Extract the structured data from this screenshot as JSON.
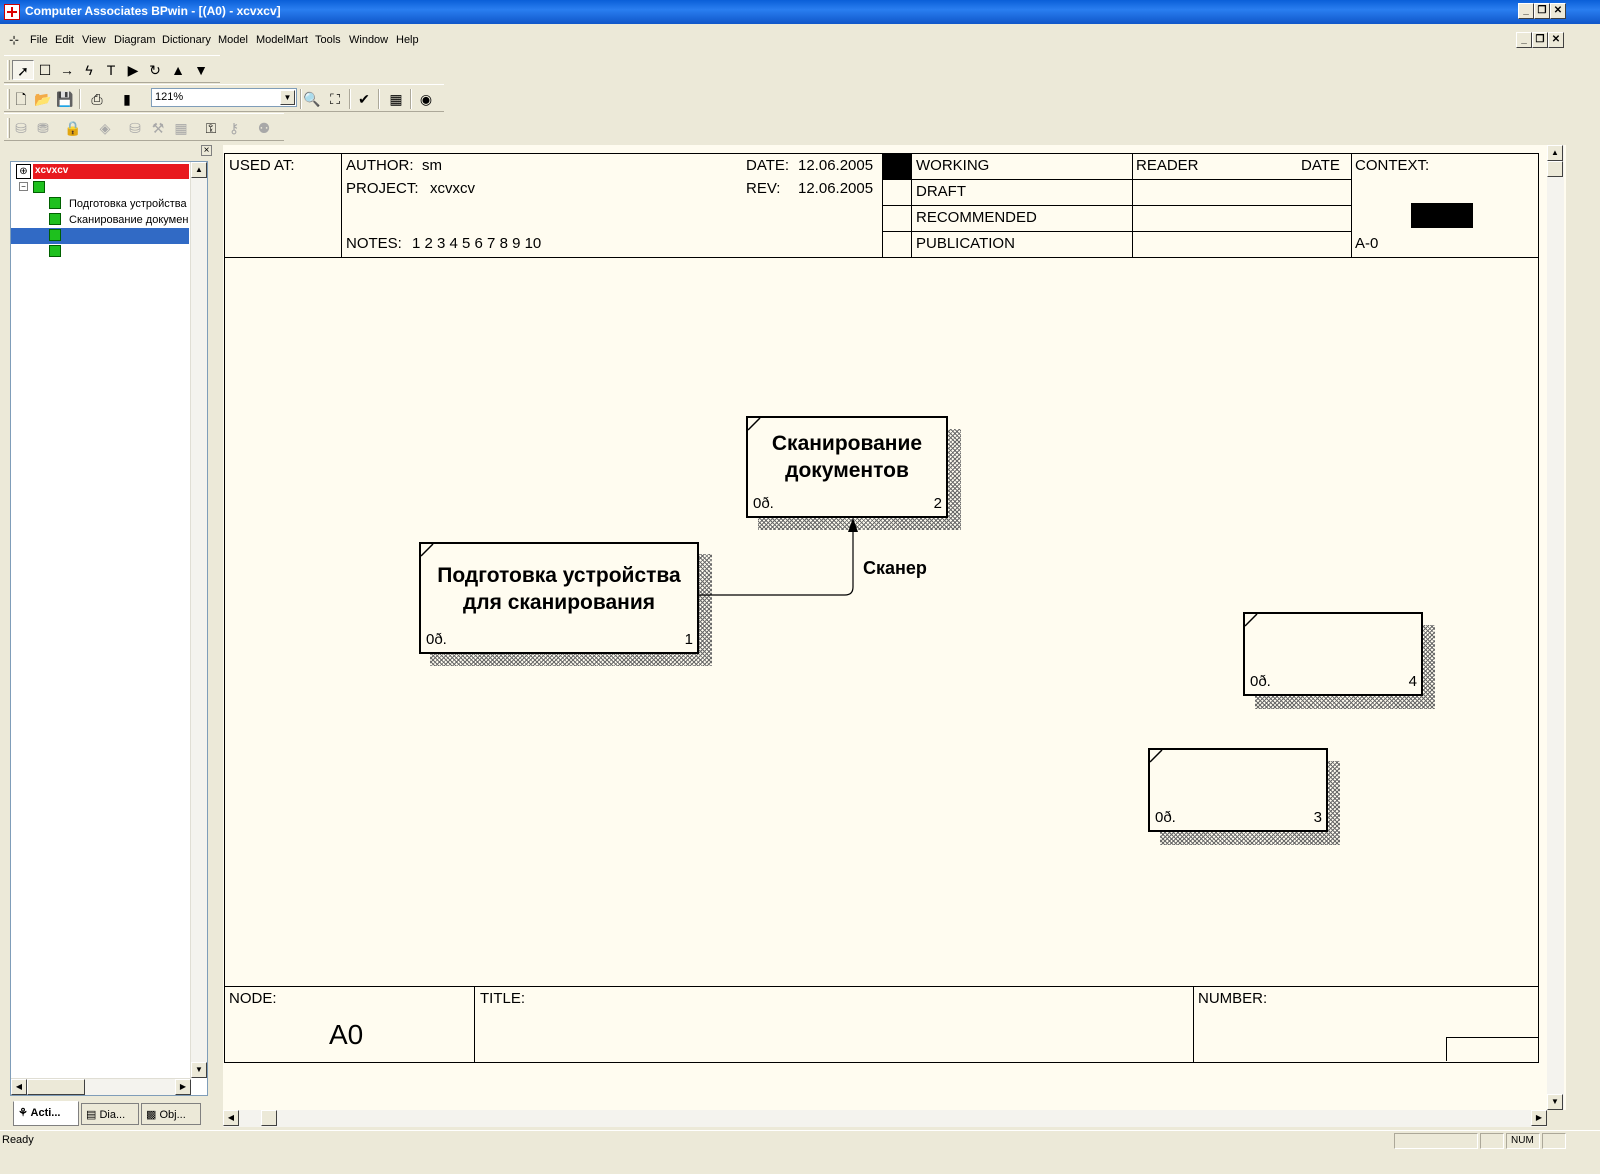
{
  "window": {
    "title": "Computer Associates BPwin - [(A0)  - xcvxcv]",
    "min_glyph": "_",
    "restore_glyph": "❐",
    "close_glyph": "✕"
  },
  "menu": [
    "File",
    "Edit",
    "View",
    "Diagram",
    "Dictionary",
    "Model",
    "ModelMart",
    "Tools",
    "Window",
    "Help"
  ],
  "toolbar": {
    "zoom_value": "121%",
    "zoom_arrow": "▼",
    "tool_icons": [
      "pointer-icon",
      "box-tool-icon",
      "arrow-tool-icon",
      "squiggle-tool-icon",
      "text-tool-icon",
      "go-to-child-icon",
      "go-back-icon",
      "go-up-icon",
      "go-down-icon"
    ]
  },
  "tree": {
    "root_label": "xcvxcv",
    "items": [
      "Подготовка устройства",
      "Сканирование докумен"
    ],
    "scroll_up": "▲",
    "scroll_down": "▼",
    "scroll_left": "◀",
    "scroll_right": "▶",
    "close_glyph": "×"
  },
  "panel_tabs": [
    "Acti...",
    "Dia...",
    "Obj..."
  ],
  "header": {
    "used_at": "USED AT:",
    "author_label": "AUTHOR:",
    "author_value": "sm",
    "project_label": "PROJECT:",
    "project_value": "xcvxcv",
    "date_label": "DATE:",
    "date_value": "12.06.2005",
    "rev_label": "REV:",
    "rev_value": "12.06.2005",
    "notes_label": "NOTES:",
    "notes_value": "1  2  3  4  5  6  7  8  9  10",
    "status_rows": [
      "WORKING",
      "DRAFT",
      "RECOMMENDED",
      "PUBLICATION"
    ],
    "reader_label": "READER",
    "reader_date_label": "DATE",
    "context_label": "CONTEXT:",
    "context_node": "A-0"
  },
  "footer": {
    "node_label": "NODE:",
    "node_value": "A0",
    "title_label": "TITLE:",
    "number_label": "NUMBER:"
  },
  "activities": [
    {
      "name": "Подготовка устройства для сканирования",
      "cost": "0ð.",
      "number": "1"
    },
    {
      "name": "Сканирование документов",
      "cost": "0ð.",
      "number": "2"
    },
    {
      "name": "",
      "cost": "0ð.",
      "number": "3"
    },
    {
      "name": "",
      "cost": "0ð.",
      "number": "4"
    }
  ],
  "arrows": [
    {
      "label": "Сканер",
      "from": "1",
      "to": "2",
      "role": "mechanism"
    }
  ],
  "status": {
    "text": "Ready",
    "num_indicator": "NUM"
  },
  "colors": {
    "title_bar": "#0a5fd8",
    "diagram_background": "#fffcf0",
    "tree_root_highlight": "#e8191e",
    "tree_selection": "#316ac5",
    "tree_node": "#1ec01e"
  }
}
